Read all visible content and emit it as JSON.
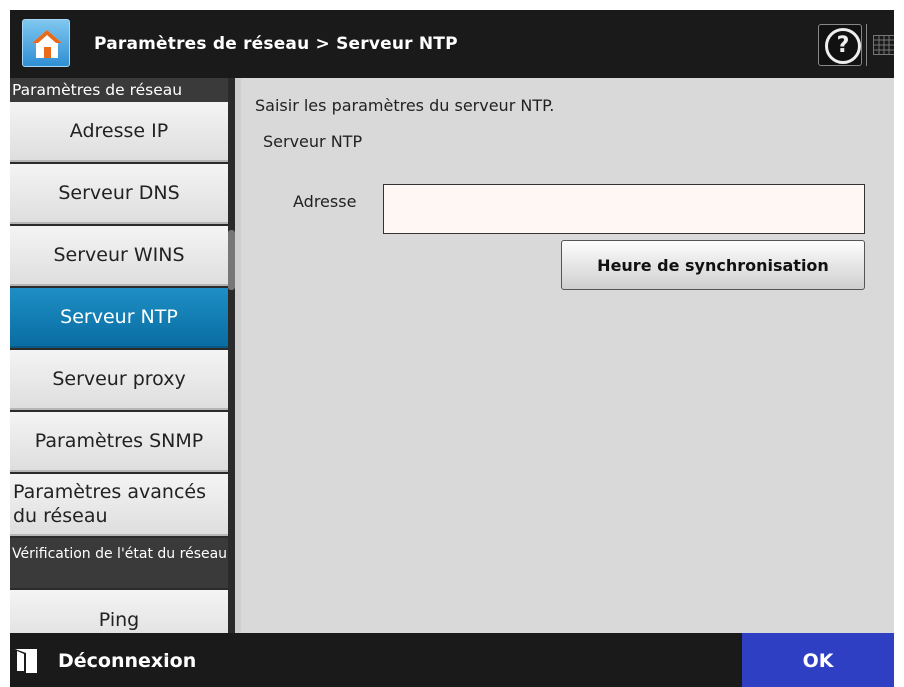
{
  "header": {
    "title": "Paramètres de réseau > Serveur NTP",
    "home_icon": "home-icon",
    "help_label": "?",
    "keyboard_icon": "keyboard-icon"
  },
  "sidebar": {
    "section_network": "Paramètres de réseau",
    "items": [
      {
        "label": "Adresse IP"
      },
      {
        "label": "Serveur DNS"
      },
      {
        "label": "Serveur WINS"
      },
      {
        "label": "Serveur NTP",
        "active": true
      },
      {
        "label": "Serveur proxy"
      },
      {
        "label": "Paramètres SNMP"
      },
      {
        "label": "Paramètres avancés du réseau"
      }
    ],
    "section_status": "Vérification de l'état du réseau",
    "status_items": [
      {
        "label": "Ping"
      }
    ]
  },
  "main": {
    "instruction": "Saisir les paramètres du serveur NTP.",
    "section_label": "Serveur NTP",
    "address_label": "Adresse",
    "address_value": "",
    "sync_button": "Heure de synchronisation"
  },
  "footer": {
    "logout_label": "Déconnexion",
    "ok_label": "OK"
  },
  "colors": {
    "header_bg": "#1a1a1a",
    "active_item": "#0a7ab5",
    "ok_button": "#2f3fc4",
    "content_bg": "#d9d9d9"
  }
}
